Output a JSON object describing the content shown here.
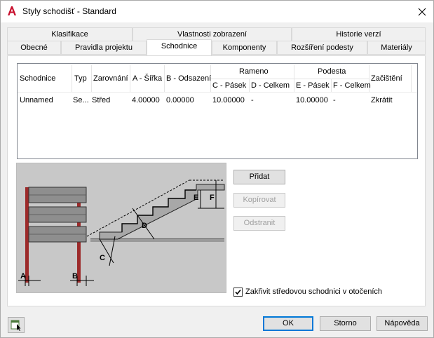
{
  "window": {
    "title": "Styly schodišť - Standard"
  },
  "tabs_row1": [
    "Klasifikace",
    "Vlastnosti zobrazení",
    "Historie verzí"
  ],
  "tabs_row2": [
    "Obecné",
    "Pravidla projektu",
    "Schodnice",
    "Komponenty",
    "Rozšíření podesty",
    "Materiály"
  ],
  "active_tab": "Schodnice",
  "table": {
    "headers": {
      "schodnice": "Schodnice",
      "typ": "Typ",
      "zarovnani": "Zarovnání",
      "a_sirka": "A - Šířka",
      "b_odsazeni": "B - Odsazení",
      "rameno": "Rameno",
      "c_pasek": "C - Pásek",
      "d_celkem": "D - Celkem",
      "podesta": "Podesta",
      "e_pasek": "E - Pásek",
      "f_celkem": "F - Celkem",
      "zacisteni": "Začištění"
    },
    "rows": [
      {
        "schodnice": "Unnamed",
        "typ": "Se...",
        "zarovnani": "Střed",
        "a_sirka": "4.00000",
        "b_odsazeni": "0.00000",
        "c_pasek": "10.00000",
        "d_celkem": "-",
        "e_pasek": "10.00000",
        "f_celkem": "-",
        "zacisteni": "Zkrátit"
      }
    ]
  },
  "diagram_labels": {
    "a": "A",
    "b": "B",
    "c": "C",
    "d": "D",
    "e": "E",
    "f": "F"
  },
  "buttons": {
    "add": "Přidat",
    "copy": "Kopírovat",
    "remove": "Odstranit",
    "ok": "OK",
    "cancel": "Storno",
    "help": "Nápověda"
  },
  "checkbox": {
    "label": "Zakřivit středovou schodnici v otočeních",
    "checked": true
  }
}
